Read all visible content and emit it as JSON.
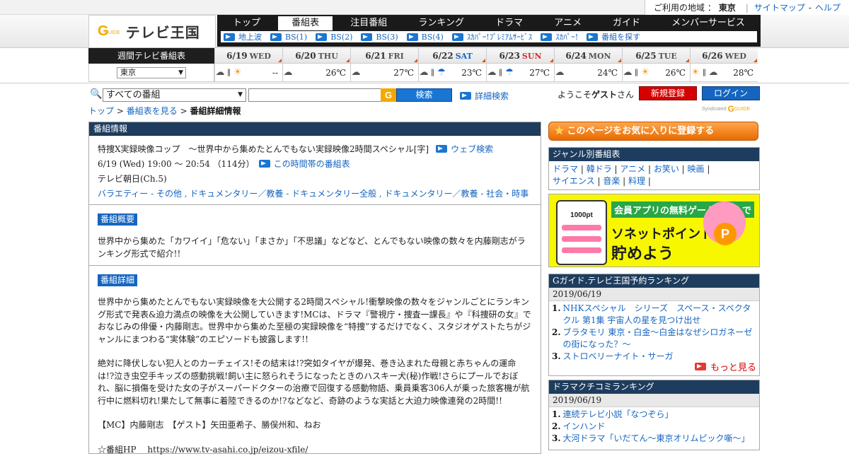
{
  "region_bar": {
    "label": "ご利用の地域 ：",
    "region": "東京",
    "links": [
      "サイトマップ",
      "ヘルプ"
    ],
    "link_sep": "-"
  },
  "logo": {
    "g": "G",
    "guide": "GUIDE",
    "text": "テレビ王国"
  },
  "nav": {
    "main": [
      "トップ",
      "番組表",
      "注目番組",
      "ランキング",
      "ドラマ",
      "アニメ",
      "ガイド",
      "メンバーサービス"
    ],
    "active": "番組表",
    "sub": [
      "地上波",
      "BS(1)",
      "BS(2)",
      "BS(3)",
      "BS(4)",
      "ｽｶﾊﾟｰ!ﾌﾟﾚﾐｱﾑｻｰﾋﾞｽ",
      "ｽｶﾊﾟｰ!",
      "番組を探す"
    ]
  },
  "weekly": {
    "label": "週間テレビ番組表",
    "area": "東京",
    "days": [
      {
        "date": "6/19",
        "dow": "WED",
        "kind": "",
        "weather": [
          "cloud",
          "sun"
        ],
        "temp": "--"
      },
      {
        "date": "6/20",
        "dow": "THU",
        "kind": "",
        "weather": [
          "cloud"
        ],
        "temp": "26℃"
      },
      {
        "date": "6/21",
        "dow": "FRI",
        "kind": "",
        "weather": [
          "cloud"
        ],
        "temp": "27℃"
      },
      {
        "date": "6/22",
        "dow": "SAT",
        "kind": "sat",
        "weather": [
          "cloud",
          "rain"
        ],
        "temp": "23℃"
      },
      {
        "date": "6/23",
        "dow": "SUN",
        "kind": "sun",
        "weather": [
          "cloud",
          "rain"
        ],
        "temp": "27℃"
      },
      {
        "date": "6/24",
        "dow": "MON",
        "kind": "",
        "weather": [
          "cloud"
        ],
        "temp": "24℃"
      },
      {
        "date": "6/25",
        "dow": "TUE",
        "kind": "",
        "weather": [
          "cloud",
          "sun"
        ],
        "temp": "26℃"
      },
      {
        "date": "6/26",
        "dow": "WED",
        "kind": "",
        "weather": [
          "sun",
          "cloud"
        ],
        "temp": "28℃"
      }
    ]
  },
  "search": {
    "genre": "すべての番組",
    "query": "",
    "g": "G",
    "button": "検索",
    "advanced": "詳細検索"
  },
  "user": {
    "welcome_prefix": "ようこそ",
    "name": "ゲスト",
    "welcome_suffix": "さん",
    "register": "新規登録",
    "login": "ログイン",
    "syndicated": "Syndicated",
    "g": "G",
    "guide": "GUIDE"
  },
  "breadcrumb": {
    "top": "トップ",
    "guide": "番組表を見る",
    "current": "番組詳細情報",
    "sep": ">"
  },
  "program": {
    "panel_title": "番組情報",
    "title": "特捜X実録映像コップ　～世界中から集めたとんでもない実録映像2時間スペシャル[字]",
    "web_search": "ウェブ検索",
    "time": "6/19 (Wed) 19:00 ～ 20:54 （114分）",
    "timeslot": "この時間帯の番組表",
    "channel": "テレビ朝日(Ch.5)",
    "genres": "バラエティー - その他 , ドキュメンタリー／教養 - ドキュメンタリー全般 , ドキュメンタリー／教養 - 社会・時事",
    "summary_label": "番組概要",
    "summary": "世界中から集めた「カワイイ」「危ない」「まさか」「不思議」などなど、とんでもない映像の数々を内藤剛志がランキング形式で紹介!!",
    "detail_label": "番組詳細",
    "detail_p1": "世界中から集めたとんでもない実録映像を大公開する2時間スペシャル!衝撃映像の数々をジャンルごとにランキング形式で発表&迫力満点の映像を大公開していきます!MCは、ドラマ『警視庁・捜査一課長』や『科捜研の女』でおなじみの俳優・内藤剛志。世界中から集めた至極の実録映像を“特捜”するだけでなく、スタジオゲストたちがジャンルにまつわる“実体験”のエピソードも披露します!!",
    "detail_p2": "絶対に降伏しない犯人とのカーチェイス!その結末は!?突如タイヤが爆発、巻き込まれた母親と赤ちゃんの運命は!?泣き虫空手キッズの感動挑戦!飼い主に怒られそうになったときのハスキー犬(秘)作戦!さらにプールでおぼれ、脳に損傷を受けた女の子がスーパードクターの治療で回復する感動物語、乗員乗客306人が乗った旅客機が航行中に燃料切れ!果たして無事に着陸できるのか!?などなど、奇跡のような実話と大迫力映像連発の2時間!!",
    "detail_p3": "【MC】内藤剛志　【ゲスト】矢田亜希子、勝俣州和、ねお",
    "detail_p4": "☆番組HP　 https://www.tv-asahi.co.jp/eizou-xfile/"
  },
  "sidebar": {
    "favorite": "このページをお気に入りに登録する",
    "genre_title": "ジャンル別番組表",
    "genre_line1": [
      "ドラマ",
      "韓ドラ",
      "アニメ",
      "お笑い",
      "映画"
    ],
    "genre_line2": [
      "サイエンス",
      "音楽",
      "料理"
    ],
    "ad": {
      "points": "1000pt",
      "line1": "会員アプリの無料ゲームで遊んで",
      "line2": "ソネットポイントを",
      "line3": "貯めよう",
      "coin": "P"
    },
    "ranking1": {
      "title": "Gガイド.テレビ王国予約ランキング",
      "date": "2019/06/19",
      "items": [
        {
          "n": "1.",
          "t": "NHKスペシャル　シリーズ　スペース・スペクタクル 第1集 宇宙人の星を見つけ出せ"
        },
        {
          "n": "2.",
          "t": "ブラタモリ 東京・白金〜白金はなぜシロガネーゼの街になった？〜"
        },
        {
          "n": "3.",
          "t": "ストロベリーナイト・サーガ"
        }
      ],
      "more": "もっと見る"
    },
    "ranking2": {
      "title": "ドラマクチコミランキング",
      "date": "2019/06/19",
      "items": [
        {
          "n": "1.",
          "t": "連続テレビ小説「なつぞら」"
        },
        {
          "n": "2.",
          "t": "インハンド"
        },
        {
          "n": "3.",
          "t": "大河ドラマ「いだてん～東京オリムピック噺～」"
        }
      ]
    }
  }
}
